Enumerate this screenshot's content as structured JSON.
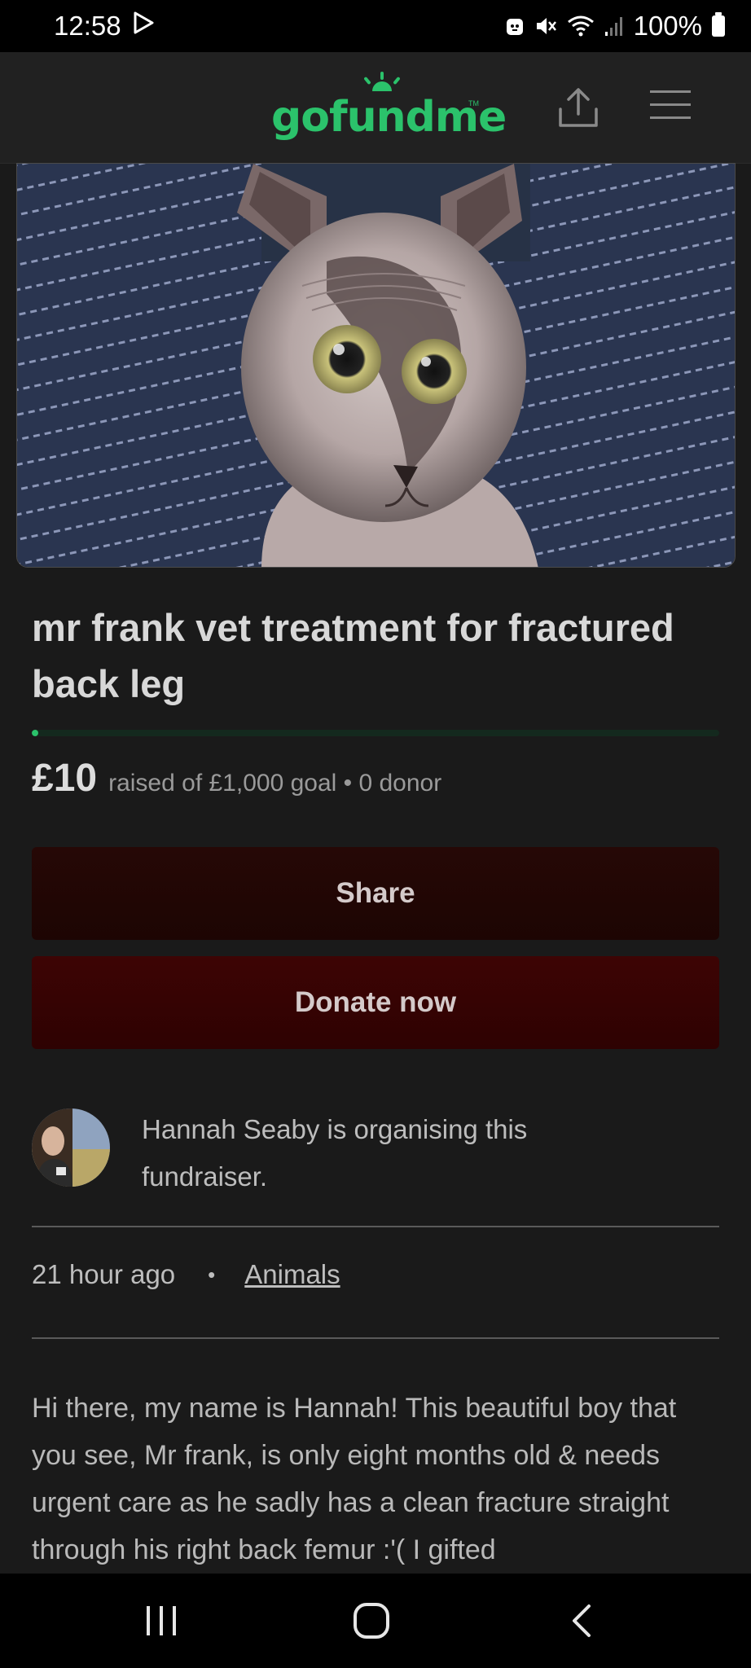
{
  "status_bar": {
    "time": "12:58",
    "battery": "100%",
    "icons": [
      "play-store-icon",
      "robot-icon",
      "mute-icon",
      "wifi-icon",
      "signal-icon",
      "battery-icon"
    ]
  },
  "header": {
    "logo": "gofundme",
    "logo_tm": "TM",
    "share_icon": "share-upload-icon",
    "menu_icon": "hamburger-menu-icon"
  },
  "campaign": {
    "title": "mr frank vet treatment for fractured back leg",
    "raised_amount": "£10",
    "raised_text": "raised of £1,000 goal • 0 donor",
    "progress": 0.01,
    "accent": "#2bc26b"
  },
  "buttons": {
    "share_label": "Share",
    "donate_label": "Donate now"
  },
  "organiser": {
    "text": "Hannah Seaby is organising this fundraiser."
  },
  "meta": {
    "time_ago": "21 hour ago",
    "separator": "•",
    "category": "Animals"
  },
  "story": "Hi there, my name is Hannah! This beautiful boy that you see, Mr frank, is only eight months old & needs urgent care as he sadly has a clean fracture straight through his right back femur :'( I gifted",
  "nav_bar": {
    "icons": [
      "recent-apps-icon",
      "home-icon",
      "back-icon"
    ]
  }
}
